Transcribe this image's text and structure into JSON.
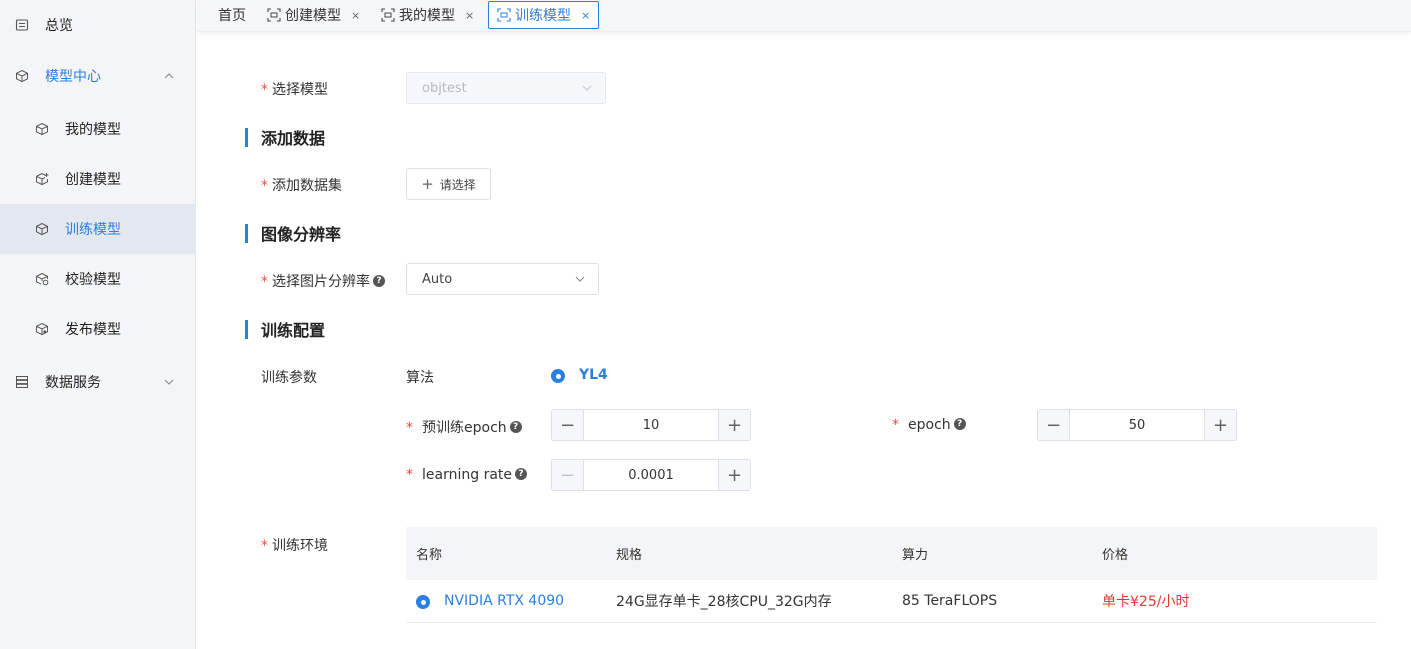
{
  "sidebar": {
    "overview": "总览",
    "model_center": "模型中心",
    "items": [
      {
        "label": "我的模型"
      },
      {
        "label": "创建模型"
      },
      {
        "label": "训练模型"
      },
      {
        "label": "校验模型"
      },
      {
        "label": "发布模型"
      }
    ],
    "data_service": "数据服务"
  },
  "tabs": {
    "home": "首页",
    "list": [
      {
        "label": "创建模型",
        "close": "×"
      },
      {
        "label": "我的模型",
        "close": "×"
      },
      {
        "label": "训练模型",
        "close": "×"
      }
    ]
  },
  "form": {
    "select_model": {
      "label": "选择模型",
      "value": "objtest"
    },
    "sec_add_data": "添加数据",
    "add_dataset": {
      "label": "添加数据集",
      "button": "请选择",
      "plus": "+"
    },
    "sec_resolution": "图像分辨率",
    "resolution": {
      "label": "选择图片分辨率",
      "value": "Auto"
    },
    "sec_train_config": "训练配置",
    "train_params": "训练参数",
    "algorithm_label": "算法",
    "algorithm_value": "YL4",
    "pretrain_epoch": {
      "label": "预训练epoch",
      "value": "10"
    },
    "epoch": {
      "label": "epoch",
      "value": "50"
    },
    "learning_rate": {
      "label": "learning rate",
      "value": "0.0001"
    },
    "stepper_minus": "−",
    "stepper_plus": "+",
    "help_glyph": "?",
    "required_mark": "*",
    "train_env": "训练环境"
  },
  "table": {
    "headers": [
      "名称",
      "规格",
      "算力",
      "价格"
    ],
    "rows": [
      {
        "name": "NVIDIA RTX 4090",
        "spec": "24G显存单卡_28核CPU_32G内存",
        "power": "85 TeraFLOPS",
        "price": "单卡¥25/小时"
      }
    ]
  },
  "colors": {
    "accent": "#2b7fe0",
    "required": "#f0493e",
    "price": "#e8382d"
  }
}
